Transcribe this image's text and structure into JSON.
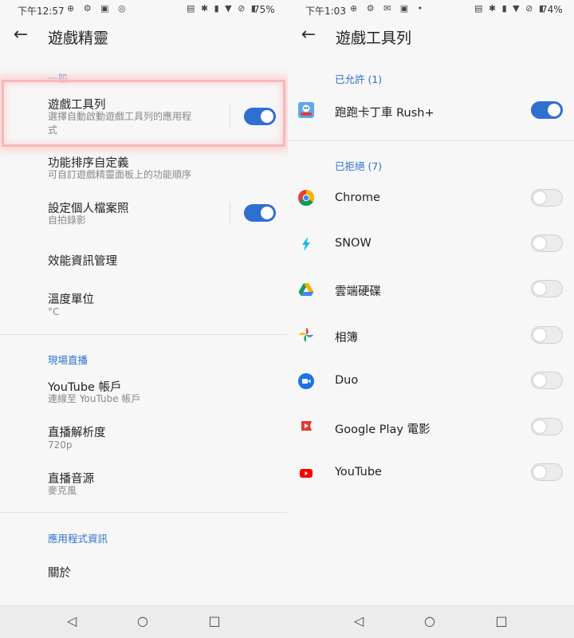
{
  "left": {
    "status": {
      "time": "下午12:57",
      "icons": "⊕ ⚙ ▣ ◎",
      "right_icons": "▤ ✱ ▮ ▼ ⊘ ▮",
      "battery": "75%"
    },
    "title": "遊戲精靈",
    "sections": {
      "general": "一般",
      "live": "現場直播",
      "app_info": "應用程式資訊"
    },
    "items": {
      "toolbar": {
        "title": "遊戲工具列",
        "subtitle_l1": "選擇自動啟動遊戲工具列的應用程",
        "subtitle_l2": "式",
        "on": true
      },
      "sort": {
        "title": "功能排序自定義",
        "subtitle": "可自訂遊戲精靈面板上的功能順序"
      },
      "profile": {
        "title": "設定個人檔案照",
        "subtitle": "自拍錄影",
        "on": true
      },
      "perf": {
        "title": "效能資訊管理"
      },
      "temp": {
        "title": "溫度單位",
        "subtitle": "°C"
      },
      "youtube": {
        "title": "YouTube 帳戶",
        "subtitle": "連線至 YouTube 帳戶"
      },
      "resolution": {
        "title": "直播解析度",
        "subtitle": "720p"
      },
      "audio": {
        "title": "直播音源",
        "subtitle": "麥克風"
      },
      "about": {
        "title": "關於"
      }
    }
  },
  "right": {
    "status": {
      "time": "下午1:03",
      "icons": "⊕ ⚙ ✉ ▣ •",
      "right_icons": "▤ ✱ ▮ ▼ ⊘ ▮",
      "battery": "74%"
    },
    "title": "遊戲工具列",
    "allowed_header": "已允許 (1)",
    "denied_header": "已拒絕 (7)",
    "allowed": [
      {
        "name": "跑跑卡丁車 Rush+",
        "icon": "kart-game-icon",
        "on": true
      }
    ],
    "denied": [
      {
        "name": "Chrome",
        "icon": "chrome-icon",
        "on": false
      },
      {
        "name": "SNOW",
        "icon": "snow-icon",
        "on": false
      },
      {
        "name": "雲端硬碟",
        "icon": "google-drive-icon",
        "on": false
      },
      {
        "name": "相簿",
        "icon": "google-photos-icon",
        "on": false
      },
      {
        "name": "Duo",
        "icon": "duo-icon",
        "on": false
      },
      {
        "name": "Google Play 電影",
        "icon": "play-movies-icon",
        "on": false
      },
      {
        "name": "YouTube",
        "icon": "youtube-icon",
        "on": false
      }
    ]
  },
  "nav": {
    "back": "◁",
    "home": "○",
    "recents": "□"
  },
  "colors": {
    "accent": "#2f6fd0",
    "highlight": "#f6b8b8"
  }
}
